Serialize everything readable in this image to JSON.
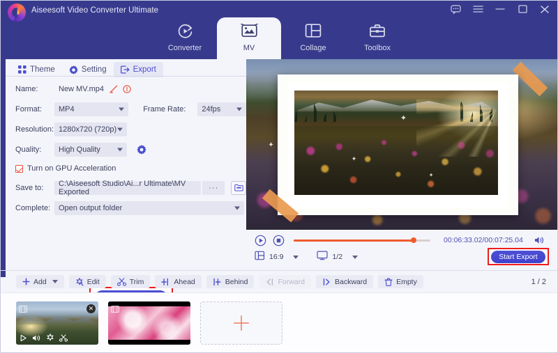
{
  "window": {
    "app_title": "Aiseesoft Video Converter Ultimate",
    "controls": [
      {
        "name": "feedback-icon",
        "glyph": "feedback"
      },
      {
        "name": "menu-icon",
        "glyph": "menu"
      },
      {
        "name": "minimize-icon",
        "glyph": "minimize"
      },
      {
        "name": "maximize-icon",
        "glyph": "maximize"
      },
      {
        "name": "close-icon",
        "glyph": "close"
      }
    ],
    "header_color": "#373a8c"
  },
  "main_nav": {
    "active": "MV",
    "tabs": [
      {
        "label": "Converter",
        "icon": "converter-icon",
        "active": false
      },
      {
        "label": "MV",
        "icon": "mv-icon",
        "active": true
      },
      {
        "label": "Collage",
        "icon": "collage-icon",
        "active": false
      },
      {
        "label": "Toolbox",
        "icon": "toolbox-icon",
        "active": false
      }
    ]
  },
  "sub_tabs": {
    "active": "Export",
    "items": [
      {
        "label": "Theme",
        "icon": "theme-grid-icon",
        "active": false
      },
      {
        "label": "Setting",
        "icon": "gear-icon",
        "active": false
      },
      {
        "label": "Export",
        "icon": "export-icon",
        "active": true
      }
    ]
  },
  "export_form": {
    "name_label": "Name:",
    "name_value": "New MV.mp4",
    "format_label": "Format:",
    "format_value": "MP4",
    "frame_rate_label": "Frame Rate:",
    "frame_rate_value": "24fps",
    "resolution_label": "Resolution:",
    "resolution_value": "1280x720 (720p)",
    "quality_label": "Quality:",
    "quality_value": "High Quality",
    "gpu_label": "Turn on GPU Acceleration",
    "gpu_checked": true,
    "save_to_label": "Save to:",
    "save_to_value": "C:\\Aiseesoft Studio\\Ai...r Ultimate\\MV Exported",
    "browse_ellipsis": "···",
    "complete_label": "Complete:",
    "complete_value": "Open output folder",
    "start_export_label": "Start Export",
    "highlight_color": "#ee1b1b"
  },
  "player": {
    "current_time": "00:06:33.02",
    "total_time": "00:07:25.04",
    "time_display": "00:06:33.02/00:07:25.04",
    "progress_percent": 88,
    "aspect_ratio": "16:9",
    "zoom_value": "1/2",
    "start_export_label": "Start Export",
    "accent_color": "#ef5a2c"
  },
  "toolbar": {
    "buttons": [
      {
        "label": "Add",
        "icon": "plus-icon",
        "has_caret": true,
        "disabled": false
      },
      {
        "label": "Edit",
        "icon": "magic-wand-icon",
        "has_caret": false,
        "disabled": false
      },
      {
        "label": "Trim",
        "icon": "scissors-icon",
        "has_caret": false,
        "disabled": false
      },
      {
        "label": "Ahead",
        "icon": "insert-ahead-icon",
        "has_caret": false,
        "disabled": false
      },
      {
        "label": "Behind",
        "icon": "insert-behind-icon",
        "has_caret": false,
        "disabled": false
      },
      {
        "label": "Forward",
        "icon": "move-forward-icon",
        "has_caret": false,
        "disabled": true
      },
      {
        "label": "Backward",
        "icon": "move-backward-icon",
        "has_caret": false,
        "disabled": false
      },
      {
        "label": "Empty",
        "icon": "trash-icon",
        "has_caret": false,
        "disabled": false
      }
    ],
    "page_indicator": "1 / 2"
  },
  "filmstrip": {
    "clips": [
      {
        "name": "clip-sunrise-mountain",
        "selected": true,
        "close_glyph": "✕",
        "tools": [
          "play-icon",
          "volume-icon",
          "effect-star-icon",
          "scissors-icon"
        ]
      },
      {
        "name": "clip-pink-abstract",
        "selected": false
      }
    ],
    "add_clip_label": "+"
  }
}
